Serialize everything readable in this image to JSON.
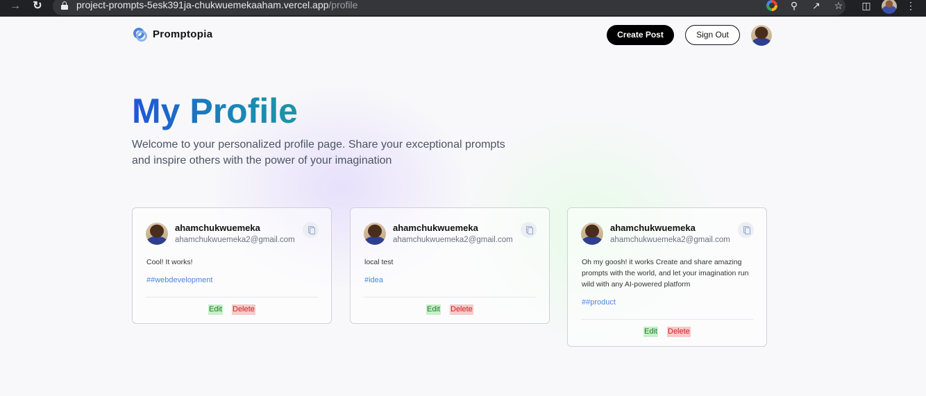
{
  "browser": {
    "url_host": "project-prompts-5esk391ja-chukwuemekaaham.vercel.app",
    "url_path": "/profile"
  },
  "navbar": {
    "brand": "Promptopia",
    "create_label": "Create Post",
    "signout_label": "Sign Out"
  },
  "hero": {
    "title": "My Profile",
    "description": "Welcome to your personalized profile page. Share your exceptional prompts and inspire others with the power of your imagination"
  },
  "posts": [
    {
      "username": "ahamchukwuemeka",
      "email": "ahamchukwuemeka2@gmail.com",
      "prompt": "Cool! It works!",
      "tag": "##webdevelopment",
      "edit_label": "Edit",
      "delete_label": "Delete"
    },
    {
      "username": "ahamchukwuemeka",
      "email": "ahamchukwuemeka2@gmail.com",
      "prompt": "local test",
      "tag": "#idea",
      "edit_label": "Edit",
      "delete_label": "Delete"
    },
    {
      "username": "ahamchukwuemeka",
      "email": "ahamchukwuemeka2@gmail.com",
      "prompt": "Oh my goosh! it works Create and share amazing prompts with the world, and let your imagination run wild with any AI-powered platform",
      "tag": "##product",
      "edit_label": "Edit",
      "delete_label": "Delete"
    }
  ],
  "icons": {
    "copy": "copy-icon",
    "logo": "promptopia-logo-icon"
  },
  "colors": {
    "title_gradient_start": "#1f56d6",
    "title_gradient_end": "#1a96a5",
    "tag": "#4a86e0",
    "edit_bg": "#c8f0c8",
    "delete_bg": "#f8c9c9"
  }
}
